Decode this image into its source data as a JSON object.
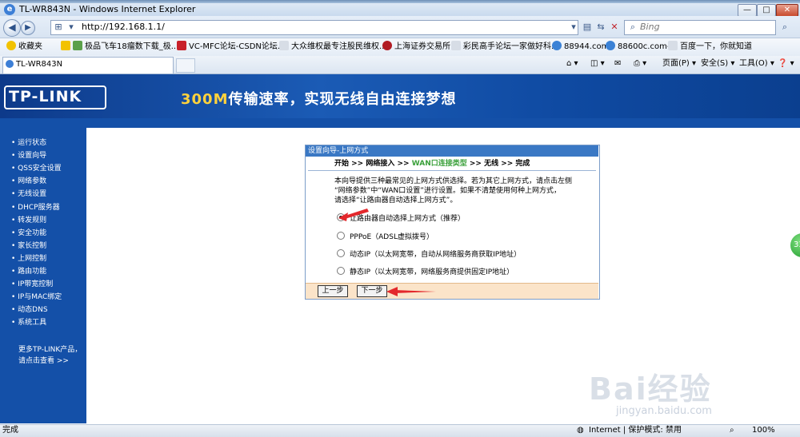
{
  "window": {
    "title": "TL-WR843N - Windows Internet Explorer",
    "min": "—",
    "max": "□",
    "close": "✕"
  },
  "address": {
    "url": "http://192.168.1.1/",
    "search_placeholder": "Bing"
  },
  "favorites": [
    "收藏夹",
    "极品飞车18瘤数下载_极...",
    "VC-MFC论坛-CSDN论坛...",
    "大众维权最专注股民维权...",
    "上海证券交易所",
    "彩民高手论坛一家做好科...",
    "88944.com-",
    "88600c.com-",
    "百度一下，你就知道"
  ],
  "tab": {
    "label": "TL-WR843N"
  },
  "commands": {
    "page": "页面(P) ▾",
    "safety": "安全(S) ▾",
    "tools": "工具(O) ▾",
    "help": "❓ ▾"
  },
  "banner": {
    "logo": "TP-LINK",
    "slogan_num": "300M",
    "slogan": "传输速率，实现无线自由连接梦想"
  },
  "sidebar": {
    "items": [
      "• 运行状态",
      "• 设置向导",
      "• QSS安全设置",
      "• 网络参数",
      "• 无线设置",
      "• DHCP服务器",
      "• 转发规则",
      "• 安全功能",
      "• 家长控制",
      "• 上网控制",
      "• 路由功能",
      "• IP带宽控制",
      "• IP与MAC绑定",
      "• 动态DNS",
      "• 系统工具"
    ],
    "more_line1": "更多TP-LINK产品，",
    "more_line2": "请点击查看 >>"
  },
  "wizard": {
    "title": "设置向导-上网方式",
    "steps_pre": "开始 >> 网络接入 >> ",
    "steps_cur": "WAN口连接类型",
    "steps_post": " >> 无线 >> 完成",
    "desc1": "本向导提供三种最常见的上网方式供选择。若为其它上网方式，请点击左侧",
    "desc2": "“网络参数”中“WAN口设置”进行设置。如果不清楚使用何种上网方式，",
    "desc3": "请选择“让路由器自动选择上网方式”。",
    "options": [
      "让路由器自动选择上网方式（推荐）",
      "PPPoE（ADSL虚拟拨号）",
      "动态IP（以太网宽带，自动从网络服务商获取IP地址）",
      "静态IP（以太网宽带，网络服务商提供固定IP地址）"
    ],
    "prev": "上一步",
    "next": "下一步"
  },
  "status": {
    "left": "完成",
    "zone": "Internet | 保护模式: 禁用",
    "zoom": "100%"
  },
  "bubble": "33",
  "watermark": {
    "main": "Bai经验",
    "sub": "jingyan.baidu.com"
  }
}
